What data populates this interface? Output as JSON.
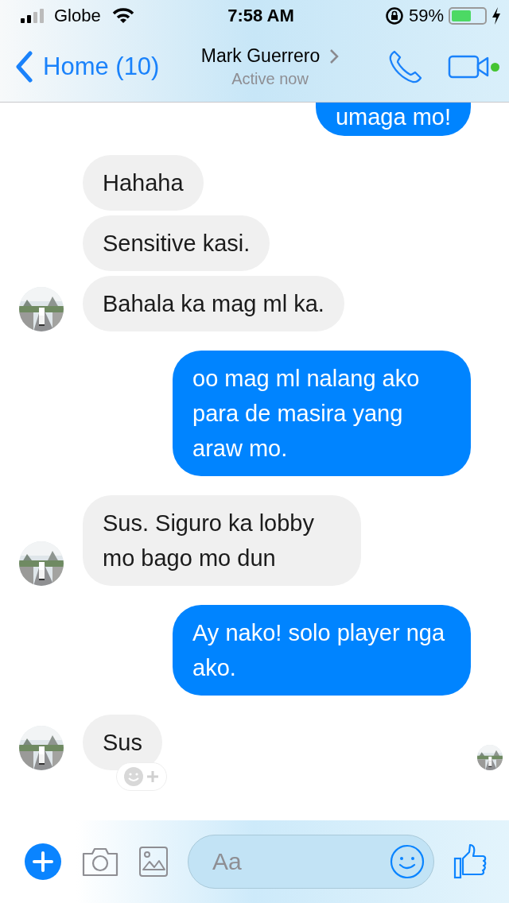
{
  "status_bar": {
    "carrier": "Globe",
    "time": "7:58 AM",
    "battery": "59%"
  },
  "header": {
    "back": "Home (10)",
    "name": "Mark Guerrero",
    "presence": "Active now",
    "online": true
  },
  "messages": [
    {
      "kind": "sent",
      "text": "umaga mo!"
    },
    {
      "kind": "received",
      "text": "Hahaha",
      "avatar": false
    },
    {
      "kind": "received",
      "text": "Sensitive kasi.",
      "avatar": false
    },
    {
      "kind": "received",
      "text": "Bahala ka mag ml ka.",
      "avatar": true
    },
    {
      "kind": "sent",
      "text": "oo mag ml nalang ako para de masira yang araw mo."
    },
    {
      "kind": "received",
      "text": "Sus. Siguro ka lobby mo bago mo dun",
      "avatar": true
    },
    {
      "kind": "sent",
      "text": "Ay nako! solo player nga ako."
    },
    {
      "kind": "received",
      "text": "Sus",
      "avatar": true,
      "reaction_button": true,
      "seen": true
    }
  ],
  "composer": {
    "placeholder": "Aa"
  }
}
